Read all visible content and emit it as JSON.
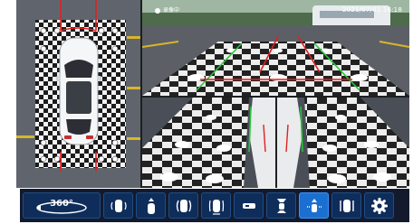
{
  "status": {
    "recording_label": "录像中",
    "timestamp": "2021/07/01 16:18"
  },
  "views": {
    "birdseye": "top-view-calibration",
    "front": "front-camera",
    "left": "left-camera",
    "right": "right-camera"
  },
  "toolbar": {
    "view_360_label": "360°",
    "buttons": [
      {
        "icon": "car-rear-left-view-icon",
        "selected": false
      },
      {
        "icon": "car-front-view-icon",
        "selected": false
      },
      {
        "icon": "car-both-sides-view-icon",
        "selected": false
      },
      {
        "icon": "car-rear-view-icon",
        "selected": false
      },
      {
        "icon": "car-narrow-view-icon",
        "selected": false
      },
      {
        "icon": "car-top-split-view-icon",
        "selected": false
      },
      {
        "icon": "car-front-wide-view-icon",
        "selected": true
      },
      {
        "icon": "car-side-mirror-view-icon",
        "selected": false
      },
      {
        "icon": "gear-icon",
        "selected": false
      }
    ]
  },
  "colors": {
    "toolbar_bg": "#131a2e",
    "button_bg": "#0f2d5a",
    "button_active": "#1b6fd0",
    "guide_red": "#e02020",
    "guide_green": "#29c43a"
  }
}
